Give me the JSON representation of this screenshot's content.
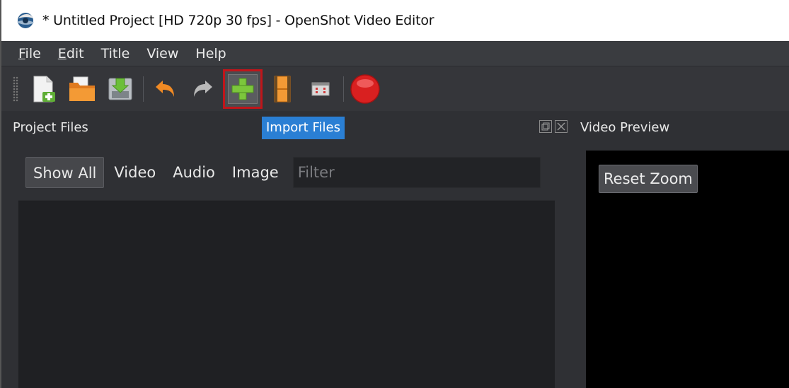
{
  "window": {
    "title": "* Untitled Project [HD 720p 30 fps] - OpenShot Video Editor"
  },
  "menubar": {
    "items": [
      {
        "first": "F",
        "rest": "ile"
      },
      {
        "first": "E",
        "rest": "dit"
      },
      {
        "first": "",
        "rest": "Title"
      },
      {
        "first": "",
        "rest": "View"
      },
      {
        "first": "",
        "rest": "Help"
      }
    ]
  },
  "toolbar": {
    "icons": [
      "new-project-icon",
      "open-project-icon",
      "save-project-icon",
      "undo-icon",
      "redo-icon",
      "import-files-icon",
      "profile-icon",
      "fullscreen-icon",
      "record-icon"
    ]
  },
  "tooltip": {
    "text": "Import Files"
  },
  "project_files": {
    "title": "Project Files",
    "filters": [
      "Show All",
      "Video",
      "Audio",
      "Image"
    ],
    "filter_placeholder": "Filter"
  },
  "video_preview": {
    "title": "Video Preview",
    "reset_zoom": "Reset Zoom"
  },
  "colors": {
    "highlight": "#c0151a",
    "tooltip": "#2a7fd4",
    "panel": "#2f3034"
  }
}
